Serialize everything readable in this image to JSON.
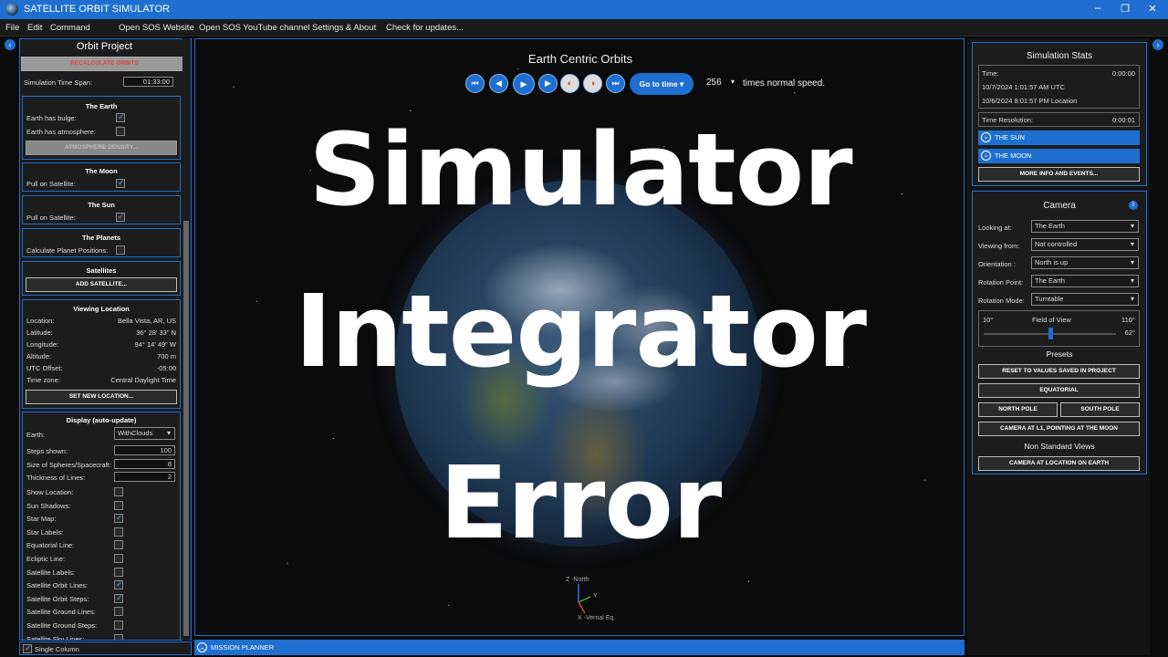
{
  "window": {
    "title": "SATELLITE ORBIT SIMULATOR"
  },
  "menu": [
    "File",
    "Edit",
    "Command",
    "Open SOS Website",
    "Open SOS YouTube channel",
    "Settings & About",
    "Check for updates..."
  ],
  "left": {
    "title": "Orbit Project",
    "recalc": "RECALCULATE ORBITS",
    "sim_span_label": "Simulation Time Span:",
    "sim_span_value": "01:33:00",
    "earth": {
      "title": "The Earth",
      "bulge": "Earth has bulge:",
      "atmo": "Earth has atmosphere:",
      "atmo_btn": "ATMOSPHERE DENSITY..."
    },
    "moon": {
      "title": "The Moon",
      "pull": "Pull on Satellite:"
    },
    "sun": {
      "title": "The Sun",
      "pull": "Pull on Satellite:"
    },
    "planets": {
      "title": "The Planets",
      "calc": "Calculate Planet Positions:"
    },
    "satellites": {
      "title": "Satellites",
      "add": "ADD SATELLITE..."
    },
    "viewing": {
      "title": "Viewing Location",
      "rows": [
        [
          "Location:",
          "Bella Vista, AR, US"
        ],
        [
          "Latitude:",
          "36° 28' 33\" N"
        ],
        [
          "Longitude:",
          "94° 14' 49\" W"
        ],
        [
          "Altitude:",
          "700 m"
        ],
        [
          "UTC Offset:",
          "-05:00"
        ],
        [
          "Time zone:",
          "Central Daylight Time"
        ]
      ],
      "set_btn": "SET NEW LOCATION..."
    },
    "display": {
      "title": "Display (auto-update)",
      "earth_label": "Earth:",
      "earth_value": "WithClouds",
      "steps_label": "Steps shown:",
      "steps_value": "100",
      "size_label": "Size of Spheres/Spacecraft:",
      "size_value": "8",
      "thick_label": "Thickness of Lines:",
      "thick_value": "2",
      "checks": [
        [
          "Show Location:",
          false
        ],
        [
          "Sun Shadows:",
          false
        ],
        [
          "Star Map:",
          true
        ],
        [
          "Star Labels:",
          false
        ],
        [
          "Equatorial Line:",
          false
        ],
        [
          "Ecliptic Line:",
          false
        ],
        [
          "Satellite Labels:",
          false
        ],
        [
          "Satellite Orbit Lines:",
          true
        ],
        [
          "Satellite Orbit Steps:",
          true
        ],
        [
          "Satellite Ground Lines:",
          false
        ],
        [
          "Satellite Ground Steps:",
          false
        ],
        [
          "Satellite Sky Lines:",
          false
        ]
      ]
    },
    "single_column": "Single Column"
  },
  "view": {
    "title": "Earth Centric Orbits",
    "goto": "Go to time ▾",
    "speed": "256",
    "speed_label": "times normal speed.",
    "overlay": [
      "Simulator",
      "Integrator",
      "Error"
    ],
    "axes": {
      "z": "Z -North",
      "y": "Y",
      "x": "X -Vernal Eq."
    }
  },
  "mission": "MISSION PLANNER",
  "stats": {
    "title": "Simulation Stats",
    "time_label": "Time:",
    "time_value": "0:00:00",
    "utc": "10/7/2024 1:01:57 AM UTC",
    "local": "10/6/2024 8:01:57 PM Location",
    "res_label": "Time Resolution:",
    "res_value": "0:00:01",
    "sun": "THE SUN",
    "moon": "THE MOON",
    "more": "MORE INFO AND EVENTS..."
  },
  "camera": {
    "title": "Camera",
    "rows": [
      [
        "Looking at:",
        "The Earth"
      ],
      [
        "Viewing from:",
        "Not controlled"
      ],
      [
        "Orientation :",
        "North is up"
      ],
      [
        "Rotation Point:",
        "The Earth"
      ],
      [
        "Rotation Mode:",
        "Turntable"
      ]
    ],
    "fov_min": "10°",
    "fov_label": "Field of View",
    "fov_max": "110°",
    "fov_value": "62°",
    "presets": "Presets",
    "reset": "RESET TO VALUES SAVED IN PROJECT",
    "equatorial": "EQUATORIAL",
    "north": "NORTH POLE",
    "south": "SOUTH POLE",
    "l1": "CAMERA AT L1, POINTING AT THE MOON",
    "nonstd": "Non Standard Views",
    "loc": "CAMERA AT LOCATION ON EARTH"
  },
  "colors": {
    "accent": "#1e6fd0"
  }
}
